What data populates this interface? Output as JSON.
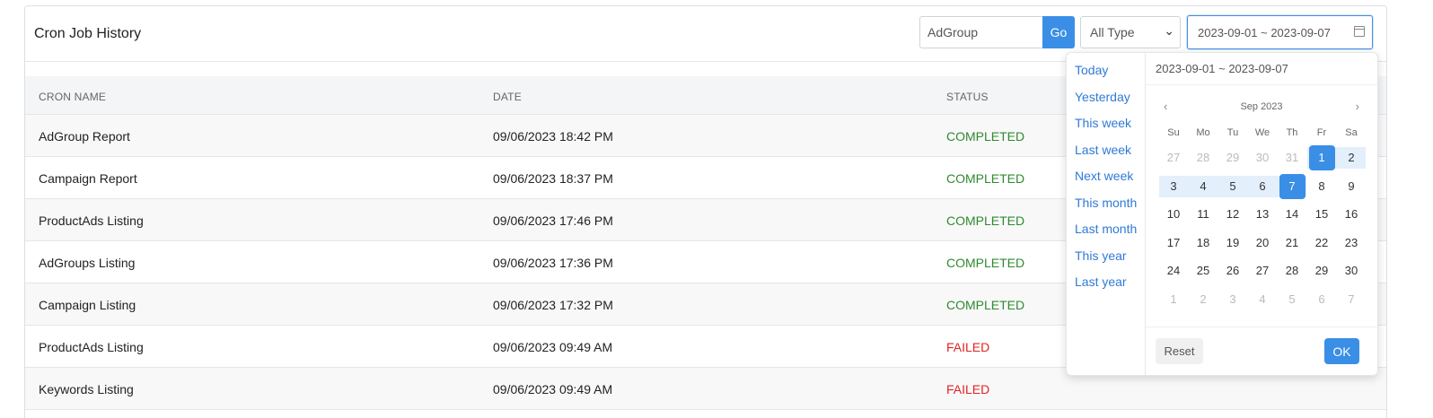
{
  "header": {
    "title": "Cron Job History",
    "search_value": "AdGroup",
    "go_label": "Go",
    "type_select": "All Type",
    "date_range": "2023-09-01 ~ 2023-09-07"
  },
  "table": {
    "columns": [
      "CRON NAME",
      "DATE",
      "STATUS"
    ],
    "rows": [
      {
        "name": "AdGroup Report",
        "date": "09/06/2023 18:42 PM",
        "status": "COMPLETED"
      },
      {
        "name": "Campaign Report",
        "date": "09/06/2023 18:37 PM",
        "status": "COMPLETED"
      },
      {
        "name": "ProductAds Listing",
        "date": "09/06/2023 17:46 PM",
        "status": "COMPLETED"
      },
      {
        "name": "AdGroups Listing",
        "date": "09/06/2023 17:36 PM",
        "status": "COMPLETED"
      },
      {
        "name": "Campaign Listing",
        "date": "09/06/2023 17:32 PM",
        "status": "COMPLETED"
      },
      {
        "name": "ProductAds Listing",
        "date": "09/06/2023 09:49 AM",
        "status": "FAILED"
      },
      {
        "name": "Keywords Listing",
        "date": "09/06/2023 09:49 AM",
        "status": "FAILED"
      }
    ]
  },
  "picker": {
    "ranges": [
      "Today",
      "Yesterday",
      "This week",
      "Last week",
      "Next week",
      "This month",
      "Last month",
      "This year",
      "Last year"
    ],
    "header_value": "2023-09-01 ~ 2023-09-07",
    "month_title": "Sep 2023",
    "prev_icon": "‹",
    "next_icon": "›",
    "weekdays": [
      "Su",
      "Mo",
      "Tu",
      "We",
      "Th",
      "Fr",
      "Sa"
    ],
    "weeks": [
      [
        "27",
        "28",
        "29",
        "30",
        "31",
        "1",
        "2"
      ],
      [
        "3",
        "4",
        "5",
        "6",
        "7",
        "8",
        "9"
      ],
      [
        "10",
        "11",
        "12",
        "13",
        "14",
        "15",
        "16"
      ],
      [
        "17",
        "18",
        "19",
        "20",
        "21",
        "22",
        "23"
      ],
      [
        "24",
        "25",
        "26",
        "27",
        "28",
        "29",
        "30"
      ],
      [
        "1",
        "2",
        "3",
        "4",
        "5",
        "6",
        "7"
      ]
    ],
    "reset_label": "Reset",
    "ok_label": "OK"
  },
  "colors": {
    "accent": "#3a8ee6",
    "completed": "#2e8b2e",
    "failed": "#e02424",
    "range_band": "#e3effb"
  }
}
